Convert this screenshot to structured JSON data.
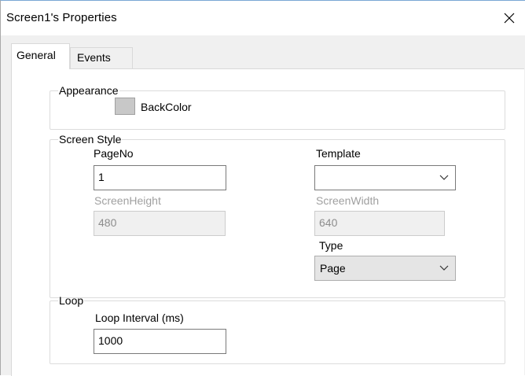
{
  "window": {
    "title": "Screen1's Properties",
    "close_icon": "close-icon"
  },
  "tabs": [
    {
      "label": "General",
      "active": true
    },
    {
      "label": "Events",
      "active": false
    }
  ],
  "appearance": {
    "legend": "Appearance",
    "back_color_label": "BackColor",
    "back_color_value": "#c8c8c8"
  },
  "screen_style": {
    "legend": "Screen Style",
    "page_no_label": "PageNo",
    "page_no_value": "1",
    "template_label": "Template",
    "template_value": "",
    "screen_height_label": "ScreenHeight",
    "screen_height_value": "480",
    "screen_width_label": "ScreenWidth",
    "screen_width_value": "640",
    "type_label": "Type",
    "type_value": "Page"
  },
  "loop": {
    "legend": "Loop",
    "interval_label": "Loop Interval (ms)",
    "interval_value": "1000"
  }
}
